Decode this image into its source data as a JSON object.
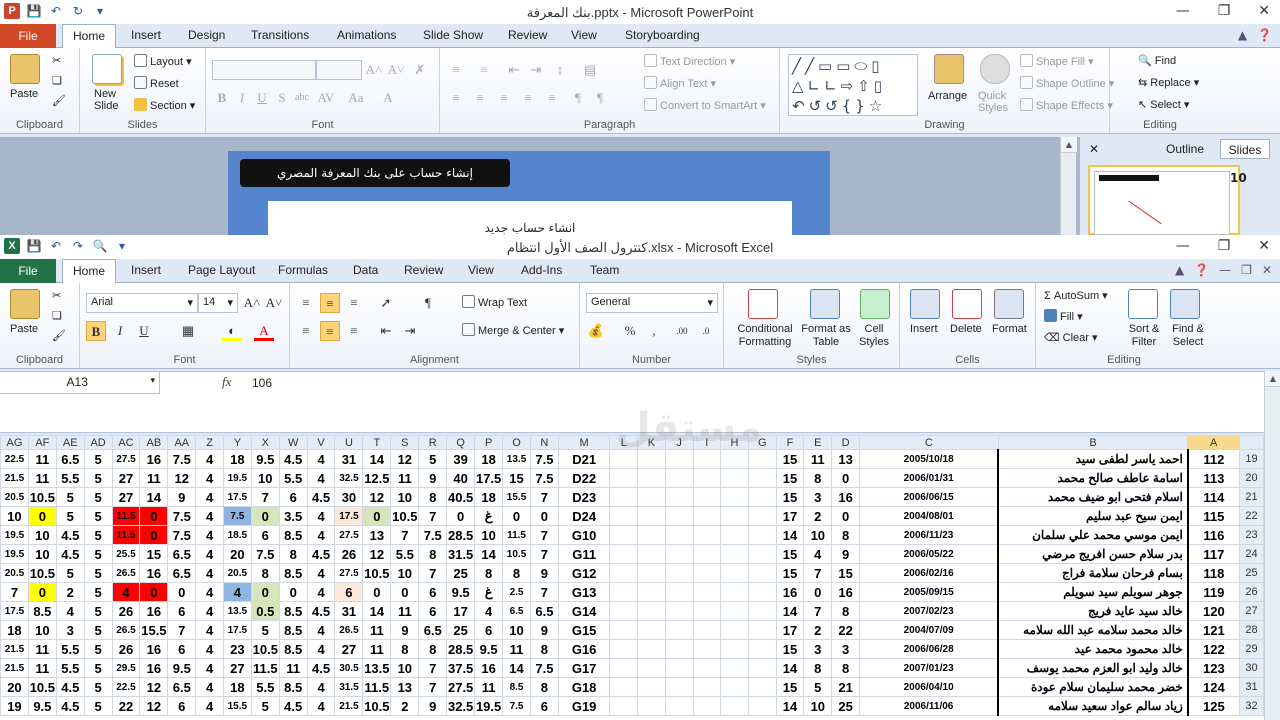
{
  "ppt": {
    "title": "بنك المعرفة.pptx  -  Microsoft PowerPoint",
    "file_tab": "File",
    "tabs": [
      "Home",
      "Insert",
      "Design",
      "Transitions",
      "Animations",
      "Slide Show",
      "Review",
      "View",
      "Storyboarding"
    ],
    "groups": {
      "clipboard": "Clipboard",
      "slides": "Slides",
      "font": "Font",
      "paragraph": "Paragraph",
      "drawing": "Drawing",
      "editing": "Editing"
    },
    "buttons": {
      "paste": "Paste",
      "new_slide": "New Slide",
      "layout": "Layout",
      "reset": "Reset",
      "section": "Section",
      "text_direction": "Text Direction",
      "align_text": "Align Text",
      "convert_smartart": "Convert to SmartArt",
      "arrange": "Arrange",
      "quick_styles": "Quick Styles",
      "shape_fill": "Shape Fill",
      "shape_outline": "Shape Outline",
      "shape_effects": "Shape Effects",
      "find": "Find",
      "replace": "Replace",
      "select": "Select"
    },
    "slide": {
      "banner": "إنشاء حساب على بنك المعرفة المصري",
      "heading": "انشاء حساب جديد"
    },
    "pane": {
      "outline": "Outline",
      "slides": "Slides",
      "slide_number": "10"
    }
  },
  "excel": {
    "title": "كنترول الصف الأول انتظام.xlsx  -  Microsoft Excel",
    "file_tab": "File",
    "tabs": [
      "Home",
      "Insert",
      "Page Layout",
      "Formulas",
      "Data",
      "Review",
      "View",
      "Add-Ins",
      "Team"
    ],
    "groups": {
      "clipboard": "Clipboard",
      "font": "Font",
      "alignment": "Alignment",
      "number": "Number",
      "styles": "Styles",
      "cells": "Cells",
      "editing": "Editing"
    },
    "buttons": {
      "paste": "Paste",
      "wrap_text": "Wrap Text",
      "merge_center": "Merge & Center",
      "conditional_formatting": "Conditional Formatting",
      "format_as_table": "Format as Table",
      "cell_styles": "Cell Styles",
      "insert": "Insert",
      "delete": "Delete",
      "format": "Format",
      "autosum": "AutoSum",
      "fill": "Fill",
      "clear": "Clear",
      "sort_filter": "Sort & Filter",
      "find_select": "Find & Select"
    },
    "font_name": "Arial",
    "font_size": "14",
    "number_format": "General",
    "name_box": "A13",
    "formula_value": "106",
    "columns": [
      "AG",
      "AF",
      "AE",
      "AD",
      "AC",
      "AB",
      "AA",
      "Z",
      "Y",
      "X",
      "W",
      "V",
      "U",
      "T",
      "S",
      "R",
      "Q",
      "P",
      "O",
      "N",
      "M",
      "L",
      "K",
      "J",
      "I",
      "H",
      "G",
      "F",
      "E",
      "D",
      "C",
      "B",
      "A"
    ],
    "rows": [
      {
        "num": "19",
        "cells": [
          "22.5",
          "11",
          "6.5",
          "5",
          "27.5",
          "16",
          "7.5",
          "4",
          "18",
          "9.5",
          "4.5",
          "4",
          "31",
          "14",
          "12",
          "5",
          "39",
          "18",
          "13.5",
          "7.5",
          "D21",
          "",
          "",
          "",
          "",
          "",
          "",
          "15",
          "11",
          "13",
          "2005/10/18",
          "احمد ياسر لطفى سيد",
          "112"
        ]
      },
      {
        "num": "20",
        "cells": [
          "21.5",
          "11",
          "5.5",
          "5",
          "27",
          "11",
          "12",
          "4",
          "19.5",
          "10",
          "5.5",
          "4",
          "32.5",
          "12.5",
          "11",
          "9",
          "40",
          "17.5",
          "15",
          "7.5",
          "D22",
          "",
          "",
          "",
          "",
          "",
          "",
          "15",
          "8",
          "0",
          "2006/01/31",
          "اسامة عاطف صالح محمد",
          "113"
        ]
      },
      {
        "num": "21",
        "cells": [
          "20.5",
          "10.5",
          "5",
          "5",
          "27",
          "14",
          "9",
          "4",
          "17.5",
          "7",
          "6",
          "4.5",
          "30",
          "12",
          "10",
          "8",
          "40.5",
          "18",
          "15.5",
          "7",
          "D23",
          "",
          "",
          "",
          "",
          "",
          "",
          "15",
          "3",
          "16",
          "2006/06/15",
          "اسلام فتحى ابو ضيف محمد",
          "114"
        ]
      },
      {
        "num": "22",
        "cells": [
          "10",
          "0",
          "5",
          "5",
          "11.5",
          "0",
          "7.5",
          "4",
          "7.5",
          "0",
          "3.5",
          "4",
          "17.5",
          "0",
          "10.5",
          "7",
          "0",
          "غ",
          "0",
          "0",
          "D24",
          "",
          "",
          "",
          "",
          "",
          "",
          "17",
          "2",
          "0",
          "2004/08/01",
          "ايمن سيح عبد سليم",
          "115"
        ]
      },
      {
        "num": "23",
        "cells": [
          "19.5",
          "10",
          "4.5",
          "5",
          "11.5",
          "0",
          "7.5",
          "4",
          "18.5",
          "6",
          "8.5",
          "4",
          "27.5",
          "13",
          "7",
          "7.5",
          "28.5",
          "10",
          "11.5",
          "7",
          "G10",
          "",
          "",
          "",
          "",
          "",
          "",
          "14",
          "10",
          "8",
          "2006/11/23",
          "ايمن موسي محمد علي سلمان",
          "116"
        ]
      },
      {
        "num": "24",
        "cells": [
          "19.5",
          "10",
          "4.5",
          "5",
          "25.5",
          "15",
          "6.5",
          "4",
          "20",
          "7.5",
          "8",
          "4.5",
          "26",
          "12",
          "5.5",
          "8",
          "31.5",
          "14",
          "10.5",
          "7",
          "G11",
          "",
          "",
          "",
          "",
          "",
          "",
          "15",
          "4",
          "9",
          "2006/05/22",
          "بدر سلام حسن افريج مرضي",
          "117"
        ]
      },
      {
        "num": "25",
        "cells": [
          "20.5",
          "10.5",
          "5",
          "5",
          "26.5",
          "16",
          "6.5",
          "4",
          "20.5",
          "8",
          "8.5",
          "4",
          "27.5",
          "10.5",
          "10",
          "7",
          "25",
          "8",
          "8",
          "9",
          "G12",
          "",
          "",
          "",
          "",
          "",
          "",
          "15",
          "7",
          "15",
          "2006/02/16",
          "بسام فرحان سلامة فراج",
          "118"
        ]
      },
      {
        "num": "26",
        "cells": [
          "7",
          "0",
          "2",
          "5",
          "4",
          "0",
          "0",
          "4",
          "4",
          "0",
          "0",
          "4",
          "6",
          "0",
          "0",
          "6",
          "9.5",
          "غ",
          "2.5",
          "7",
          "G13",
          "",
          "",
          "",
          "",
          "",
          "",
          "16",
          "0",
          "16",
          "2005/09/15",
          "جوهر سويلم سيد سويلم",
          "119"
        ]
      },
      {
        "num": "27",
        "cells": [
          "17.5",
          "8.5",
          "4",
          "5",
          "26",
          "16",
          "6",
          "4",
          "13.5",
          "0.5",
          "8.5",
          "4.5",
          "31",
          "14",
          "11",
          "6",
          "17",
          "4",
          "6.5",
          "6.5",
          "G14",
          "",
          "",
          "",
          "",
          "",
          "",
          "14",
          "7",
          "8",
          "2007/02/23",
          "خالد سيد عايد فريج",
          "120"
        ]
      },
      {
        "num": "28",
        "cells": [
          "18",
          "10",
          "3",
          "5",
          "26.5",
          "15.5",
          "7",
          "4",
          "17.5",
          "5",
          "8.5",
          "4",
          "26.5",
          "11",
          "9",
          "6.5",
          "25",
          "6",
          "10",
          "9",
          "G15",
          "",
          "",
          "",
          "",
          "",
          "",
          "17",
          "2",
          "22",
          "2004/07/09",
          "خالد محمد سلامه عبد الله سلامه",
          "121"
        ]
      },
      {
        "num": "29",
        "cells": [
          "21.5",
          "11",
          "5.5",
          "5",
          "26",
          "16",
          "6",
          "4",
          "23",
          "10.5",
          "8.5",
          "4",
          "27",
          "11",
          "8",
          "8",
          "28.5",
          "9.5",
          "11",
          "8",
          "G16",
          "",
          "",
          "",
          "",
          "",
          "",
          "15",
          "3",
          "3",
          "2006/06/28",
          "خالد محمود محمد عيد",
          "122"
        ]
      },
      {
        "num": "30",
        "cells": [
          "21.5",
          "11",
          "5.5",
          "5",
          "29.5",
          "16",
          "9.5",
          "4",
          "27",
          "11.5",
          "11",
          "4.5",
          "30.5",
          "13.5",
          "10",
          "7",
          "37.5",
          "16",
          "14",
          "7.5",
          "G17",
          "",
          "",
          "",
          "",
          "",
          "",
          "14",
          "8",
          "8",
          "2007/01/23",
          "خالد وليد ابو العزم محمد يوسف",
          "123"
        ]
      },
      {
        "num": "31",
        "cells": [
          "20",
          "10.5",
          "4.5",
          "5",
          "22.5",
          "12",
          "6.5",
          "4",
          "18",
          "5.5",
          "8.5",
          "4",
          "31.5",
          "11.5",
          "13",
          "7",
          "27.5",
          "11",
          "8.5",
          "8",
          "G18",
          "",
          "",
          "",
          "",
          "",
          "",
          "15",
          "5",
          "21",
          "2006/04/10",
          "خضر محمد سليمان سلام عودة",
          "124"
        ]
      },
      {
        "num": "32",
        "cells": [
          "19",
          "9.5",
          "4.5",
          "5",
          "22",
          "12",
          "6",
          "4",
          "15.5",
          "5",
          "4.5",
          "4",
          "21.5",
          "10.5",
          "2",
          "9",
          "32.5",
          "19.5",
          "7.5",
          "6",
          "G19",
          "",
          "",
          "",
          "",
          "",
          "",
          "14",
          "10",
          "25",
          "2006/11/06",
          "زياد سالم عواد سعيد سلامه",
          "125"
        ]
      }
    ],
    "highlights": {
      "yellow": "#ffff00",
      "red": "#ff0000",
      "blue": "#8db4e2",
      "green": "#d8e4bc",
      "peach": "#fde9d9"
    }
  }
}
